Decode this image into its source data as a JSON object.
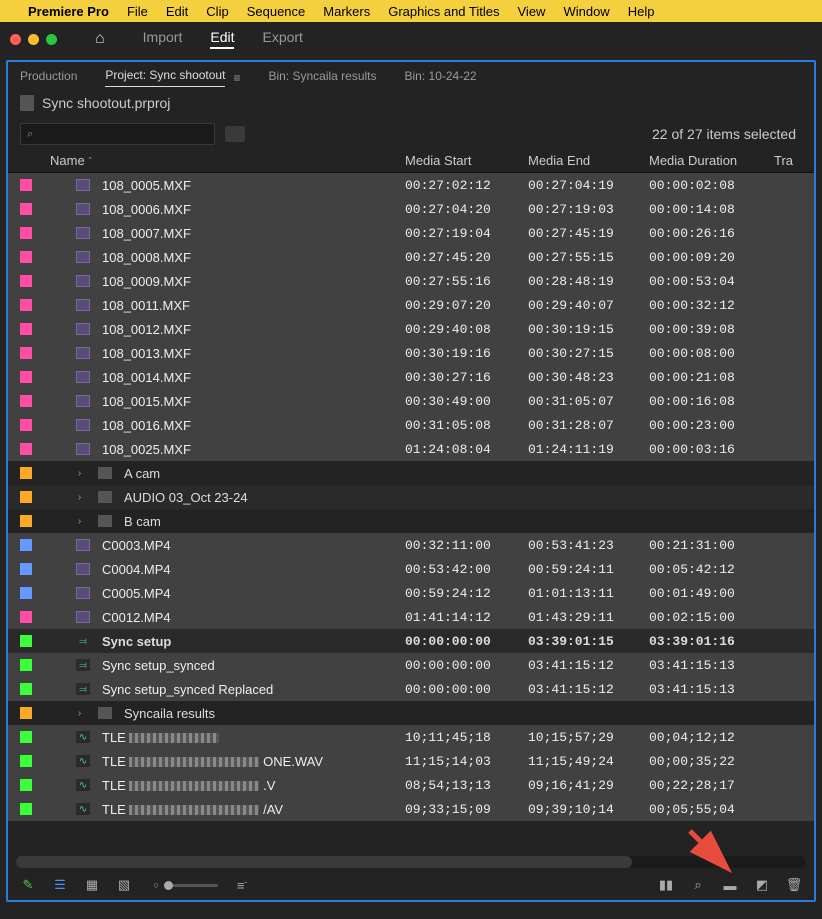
{
  "menubar": {
    "app": "Premiere Pro",
    "items": [
      "File",
      "Edit",
      "Clip",
      "Sequence",
      "Markers",
      "Graphics and Titles",
      "View",
      "Window",
      "Help"
    ]
  },
  "topTabs": {
    "import": "Import",
    "edit": "Edit",
    "export": "Export"
  },
  "panelTabs": {
    "production": "Production",
    "project": "Project: Sync shootout",
    "bin1": "Bin: Syncaila results",
    "bin2": "Bin: 10-24-22"
  },
  "projectFile": "Sync shootout.prproj",
  "selectionCount": "22 of 27 items selected",
  "headers": {
    "name": "Name",
    "start": "Media Start",
    "end": "Media End",
    "dur": "Media Duration",
    "tra": "Tra"
  },
  "rows": [
    {
      "color": "#ff4da6",
      "icon": "video",
      "name": "108_0005.MXF",
      "start": "00:27:02:12",
      "end": "00:27:04:19",
      "dur": "00:00:02:08",
      "sel": true
    },
    {
      "color": "#ff4da6",
      "icon": "video",
      "name": "108_0006.MXF",
      "start": "00:27:04:20",
      "end": "00:27:19:03",
      "dur": "00:00:14:08",
      "sel": true
    },
    {
      "color": "#ff4da6",
      "icon": "video",
      "name": "108_0007.MXF",
      "start": "00:27:19:04",
      "end": "00:27:45:19",
      "dur": "00:00:26:16",
      "sel": true
    },
    {
      "color": "#ff4da6",
      "icon": "video",
      "name": "108_0008.MXF",
      "start": "00:27:45:20",
      "end": "00:27:55:15",
      "dur": "00:00:09:20",
      "sel": true
    },
    {
      "color": "#ff4da6",
      "icon": "video",
      "name": "108_0009.MXF",
      "start": "00:27:55:16",
      "end": "00:28:48:19",
      "dur": "00:00:53:04",
      "sel": true
    },
    {
      "color": "#ff4da6",
      "icon": "video",
      "name": "108_0011.MXF",
      "start": "00:29:07:20",
      "end": "00:29:40:07",
      "dur": "00:00:32:12",
      "sel": true
    },
    {
      "color": "#ff4da6",
      "icon": "video",
      "name": "108_0012.MXF",
      "start": "00:29:40:08",
      "end": "00:30:19:15",
      "dur": "00:00:39:08",
      "sel": true
    },
    {
      "color": "#ff4da6",
      "icon": "video",
      "name": "108_0013.MXF",
      "start": "00:30:19:16",
      "end": "00:30:27:15",
      "dur": "00:00:08:00",
      "sel": true
    },
    {
      "color": "#ff4da6",
      "icon": "video",
      "name": "108_0014.MXF",
      "start": "00:30:27:16",
      "end": "00:30:48:23",
      "dur": "00:00:21:08",
      "sel": true
    },
    {
      "color": "#ff4da6",
      "icon": "video",
      "name": "108_0015.MXF",
      "start": "00:30:49:00",
      "end": "00:31:05:07",
      "dur": "00:00:16:08",
      "sel": true
    },
    {
      "color": "#ff4da6",
      "icon": "video",
      "name": "108_0016.MXF",
      "start": "00:31:05:08",
      "end": "00:31:28:07",
      "dur": "00:00:23:00",
      "sel": true
    },
    {
      "color": "#ff4da6",
      "icon": "video",
      "name": "108_0025.MXF",
      "start": "01:24:08:04",
      "end": "01:24:11:19",
      "dur": "00:00:03:16",
      "sel": true
    },
    {
      "color": "#ffa726",
      "icon": "folder",
      "name": "A cam",
      "bin": true,
      "twisty": true
    },
    {
      "color": "#ffa726",
      "icon": "folder",
      "name": "AUDIO 03_Oct 23-24",
      "bin": true,
      "twisty": true
    },
    {
      "color": "#ffa726",
      "icon": "folder",
      "name": "B cam",
      "bin": true,
      "twisty": true
    },
    {
      "color": "#6699ff",
      "icon": "video",
      "name": "C0003.MP4",
      "start": "00:32:11:00",
      "end": "00:53:41:23",
      "dur": "00:21:31:00",
      "sel": true
    },
    {
      "color": "#6699ff",
      "icon": "video",
      "name": "C0004.MP4",
      "start": "00:53:42:00",
      "end": "00:59:24:11",
      "dur": "00:05:42:12",
      "sel": true
    },
    {
      "color": "#6699ff",
      "icon": "video",
      "name": "C0005.MP4",
      "start": "00:59:24:12",
      "end": "01:01:13:11",
      "dur": "00:01:49:00",
      "sel": true
    },
    {
      "color": "#ff4da6",
      "icon": "video",
      "name": "C0012.MP4",
      "start": "01:41:14:12",
      "end": "01:43:29:11",
      "dur": "00:02:15:00",
      "sel": true
    },
    {
      "color": "#3cff3c",
      "icon": "seq",
      "name": "Sync setup",
      "start": "00:00:00:00",
      "end": "03:39:01:15",
      "dur": "03:39:01:16",
      "bold": true
    },
    {
      "color": "#3cff3c",
      "icon": "seq",
      "name": "Sync setup_synced",
      "start": "00:00:00:00",
      "end": "03:41:15:12",
      "dur": "03:41:15:13",
      "sel": true
    },
    {
      "color": "#3cff3c",
      "icon": "seq",
      "name": "Sync setup_synced Replaced",
      "start": "00:00:00:00",
      "end": "03:41:15:12",
      "dur": "03:41:15:13",
      "sel": true
    },
    {
      "color": "#ffa726",
      "icon": "folder",
      "name": "Syncaila results",
      "bin": true,
      "twisty": true
    },
    {
      "color": "#3cff3c",
      "icon": "audio",
      "name": "TLE",
      "redact": 90,
      "suffix": "",
      "start": "10;11;45;18",
      "end": "10;15;57;29",
      "dur": "00;04;12;12",
      "sel": true
    },
    {
      "color": "#3cff3c",
      "icon": "audio",
      "name": "TLE",
      "redact": 130,
      "suffix": "ONE.WAV",
      "start": "11;15;14;03",
      "end": "11;15;49;24",
      "dur": "00;00;35;22",
      "sel": true
    },
    {
      "color": "#3cff3c",
      "icon": "audio",
      "name": "TLE",
      "redact": 130,
      "suffix": ".V",
      "start": "08;54;13;13",
      "end": "09;16;41;29",
      "dur": "00;22;28;17",
      "sel": true
    },
    {
      "color": "#3cff3c",
      "icon": "audio",
      "name": "TLE",
      "redact": 130,
      "suffix": "/AV",
      "start": "09;33;15;09",
      "end": "09;39;10;14",
      "dur": "00;05;55;04",
      "sel": true
    }
  ]
}
